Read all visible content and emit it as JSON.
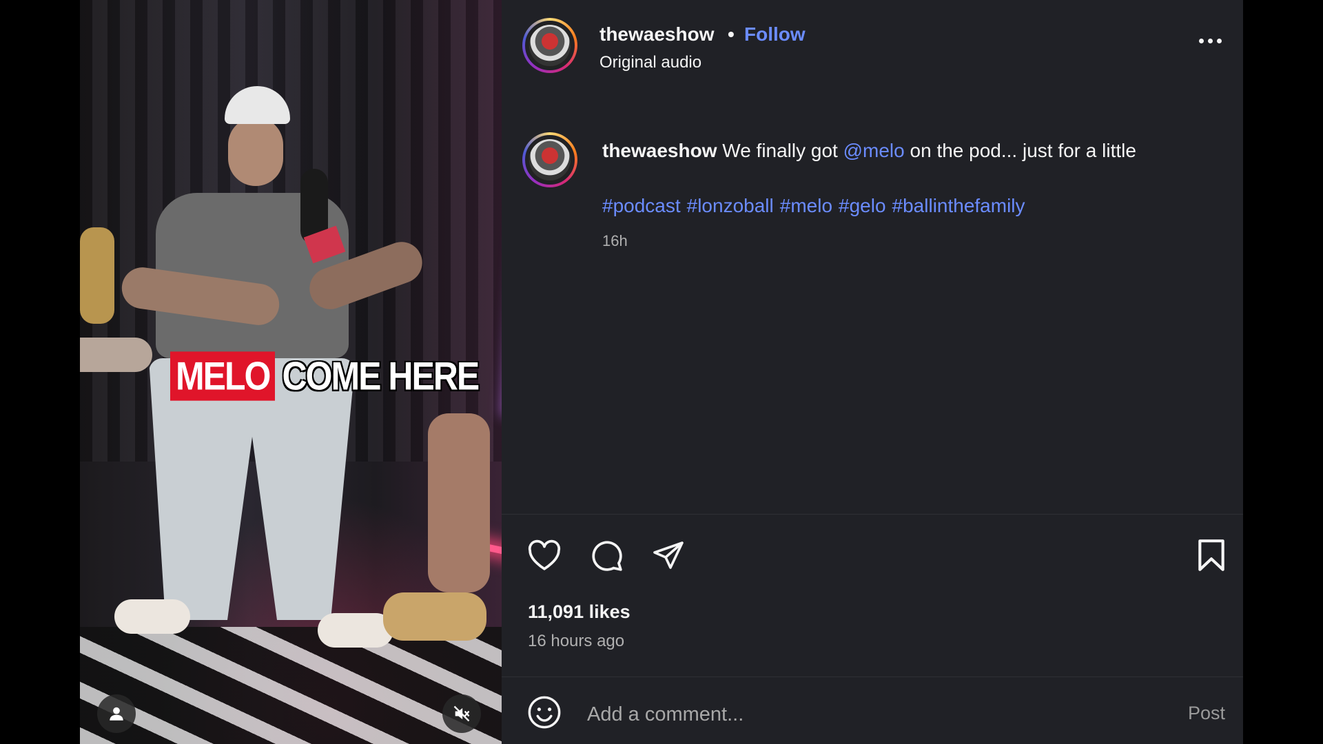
{
  "video": {
    "caption_red": "MELO",
    "caption_white": "COME HERE",
    "icons": {
      "user": "user-icon",
      "mute": "muted-speaker-icon"
    }
  },
  "post": {
    "username": "thewaeshow",
    "separator": "•",
    "follow_label": "Follow",
    "audio_label": "Original audio",
    "more_icon": "more-options-icon",
    "caption": {
      "username": "thewaeshow",
      "text_before": "We finally got",
      "mention": "@melo",
      "text_after": "on the pod... just for a little"
    },
    "hashtags": [
      "#podcast",
      "#lonzoball",
      "#melo",
      "#gelo",
      "#ballinthefamily"
    ],
    "caption_time": "16h",
    "actions": {
      "like_icon": "heart-icon",
      "comment_icon": "comment-icon",
      "share_icon": "send-icon",
      "save_icon": "bookmark-icon"
    },
    "likes": "11,091 likes",
    "time_ago": "16 hours ago",
    "comment": {
      "emoji_icon": "emoji-icon",
      "placeholder": "Add a comment...",
      "post_label": "Post"
    }
  },
  "colors": {
    "panel_bg": "#202126",
    "link": "#6b8cff",
    "caption_red": "#e0152a"
  }
}
